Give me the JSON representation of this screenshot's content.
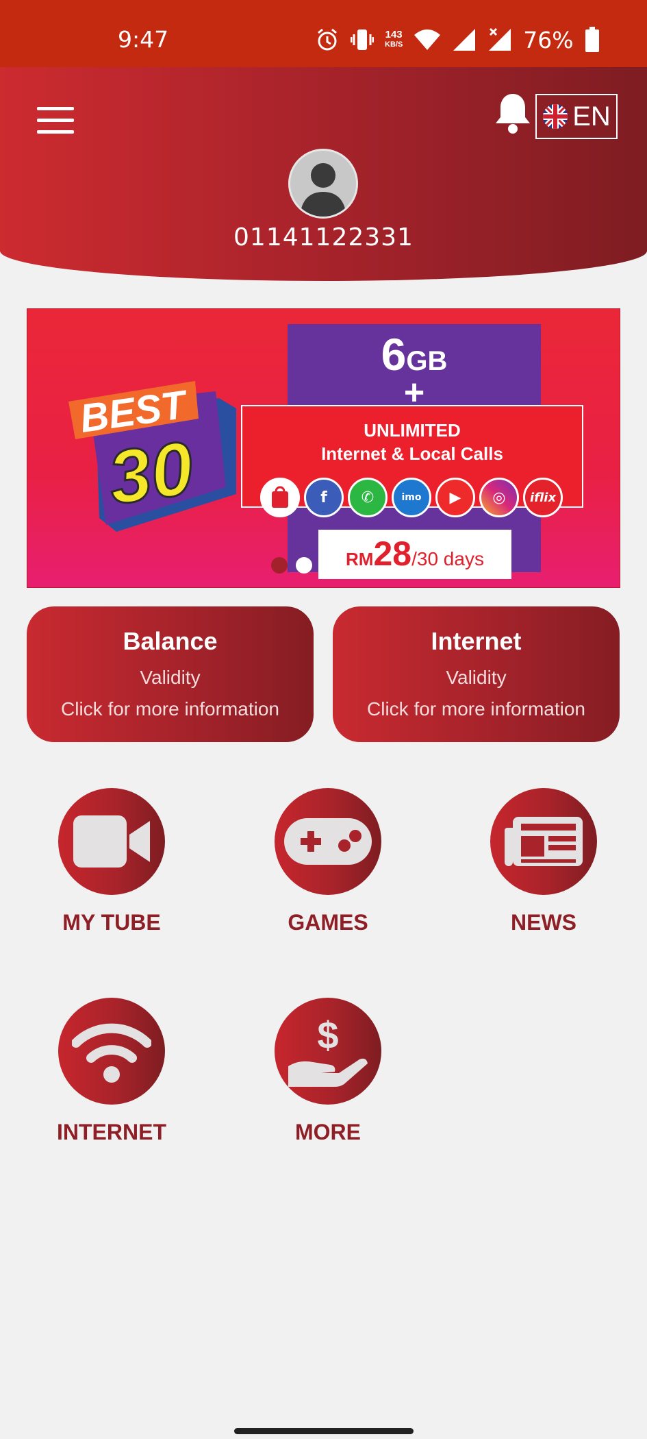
{
  "status_bar": {
    "time": "9:47",
    "network_speed_value": "143",
    "network_speed_unit": "KB/S",
    "battery": "76%",
    "icons": [
      "alarm-icon",
      "vibrate-icon",
      "wifi-icon",
      "signal-icon",
      "signal-no-data-icon",
      "battery-icon"
    ]
  },
  "header": {
    "menu_icon": "hamburger-icon",
    "notification_icon": "bell-icon",
    "language": "EN",
    "phone_number": "01141122331"
  },
  "banner": {
    "best_text": "BEST",
    "best_number": "30",
    "data_amount": "6",
    "data_unit": "GB",
    "plus": "+",
    "line1": "UNLIMITED",
    "line2": "Internet & Local Calls",
    "apps": [
      "store",
      "f",
      "wa",
      "imo",
      "yt",
      "ig",
      "iflix"
    ],
    "price_currency": "RM",
    "price_amount": "28",
    "price_period": "/30 days",
    "slide_count": 2,
    "active_slide": 1
  },
  "cards": [
    {
      "title": "Balance",
      "sub": "Validity",
      "more": "Click for more information"
    },
    {
      "title": "Internet",
      "sub": "Validity",
      "more": "Click for more information"
    }
  ],
  "menu": [
    {
      "label": "MY TUBE",
      "icon": "video-camera-icon"
    },
    {
      "label": "GAMES",
      "icon": "gamepad-icon"
    },
    {
      "label": "NEWS",
      "icon": "newspaper-icon"
    },
    {
      "label": "INTERNET",
      "icon": "wifi-icon"
    },
    {
      "label": "MORE",
      "icon": "money-hand-icon"
    }
  ],
  "colors": {
    "status_bar": "#c42a10",
    "brand_red": "#a3222a",
    "label_red": "#8e1f27",
    "background": "#f2f1f1"
  }
}
